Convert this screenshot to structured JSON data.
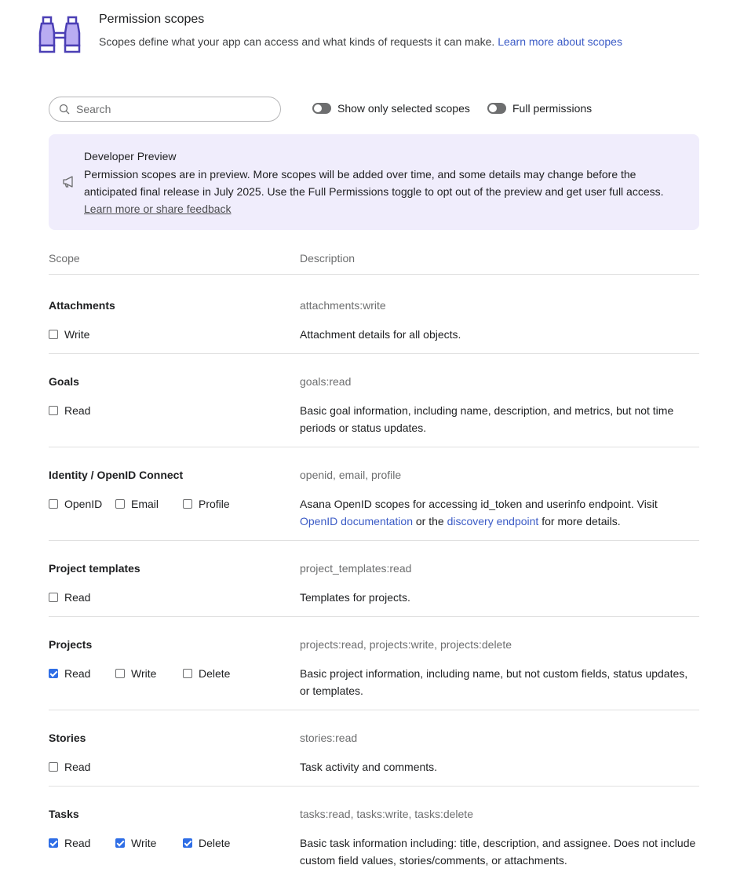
{
  "header": {
    "title": "Permission scopes",
    "subtitle": "Scopes define what your app can access and what kinds of requests it can make.",
    "learn_more": "Learn more about scopes",
    "icon": "binoculars-icon"
  },
  "search": {
    "placeholder": "Search",
    "value": ""
  },
  "toggles": {
    "show_selected_label": "Show only selected scopes",
    "show_selected_on": false,
    "full_permissions_label": "Full permissions",
    "full_permissions_on": false
  },
  "banner": {
    "title": "Developer Preview",
    "text": "Permission scopes are in preview. More scopes will be added over time, and some details may change before the anticipated final release in July 2025. Use the Full Permissions toggle to opt out of the preview and get user full access.",
    "link": "Learn more or share feedback",
    "icon": "megaphone-icon"
  },
  "columns": {
    "scope": "Scope",
    "description": "Description"
  },
  "rows": [
    {
      "title": "Attachments",
      "code": "attachments:write",
      "description": "Attachment details for all objects.",
      "options": [
        {
          "label": "Write",
          "checked": false
        }
      ]
    },
    {
      "title": "Goals",
      "code": "goals:read",
      "description": "Basic goal information, including name, description, and metrics, but not time periods or status updates.",
      "options": [
        {
          "label": "Read",
          "checked": false
        }
      ]
    },
    {
      "title": "Identity / OpenID Connect",
      "code": "openid, email, profile",
      "description_parts": {
        "pre": "Asana OpenID scopes for accessing id_token and userinfo endpoint. Visit ",
        "link1": "OpenID documentation",
        "mid": " or the ",
        "link2": "discovery endpoint",
        "post": " for more details."
      },
      "options": [
        {
          "label": "OpenID",
          "checked": false
        },
        {
          "label": "Email",
          "checked": false
        },
        {
          "label": "Profile",
          "checked": false
        }
      ]
    },
    {
      "title": "Project templates",
      "code": "project_templates:read",
      "description": "Templates for projects.",
      "options": [
        {
          "label": "Read",
          "checked": false
        }
      ]
    },
    {
      "title": "Projects",
      "code": "projects:read, projects:write, projects:delete",
      "description": "Basic project information, including name, but not custom fields, status updates, or templates.",
      "options": [
        {
          "label": "Read",
          "checked": true
        },
        {
          "label": "Write",
          "checked": false
        },
        {
          "label": "Delete",
          "checked": false
        }
      ]
    },
    {
      "title": "Stories",
      "code": "stories:read",
      "description": "Task activity and comments.",
      "options": [
        {
          "label": "Read",
          "checked": false
        }
      ]
    },
    {
      "title": "Tasks",
      "code": "tasks:read, tasks:write, tasks:delete",
      "description": "Basic task information including: title, description, and assignee. Does not include custom field values, stories/comments, or attachments.",
      "options": [
        {
          "label": "Read",
          "checked": true
        },
        {
          "label": "Write",
          "checked": true
        },
        {
          "label": "Delete",
          "checked": true
        }
      ]
    }
  ],
  "colors": {
    "accent": "#3b5bc6",
    "checkbox": "#2f6ee6",
    "banner_bg": "#f0edfc"
  }
}
